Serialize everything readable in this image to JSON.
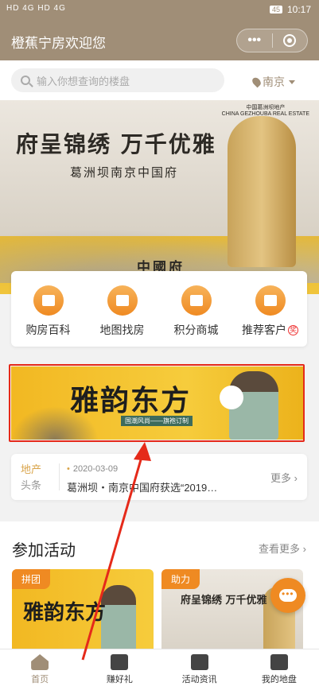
{
  "statusbar": {
    "left": "HD 4G HD 4G",
    "battery": "45",
    "time": "10:17"
  },
  "header": {
    "title": "橙蕉宁房欢迎您",
    "more": "•••"
  },
  "search": {
    "placeholder": "输入你想查询的楼盘",
    "city": "南京"
  },
  "hero": {
    "title": "府呈锦绣 万千优雅",
    "subtitle": "葛洲坝南京中国府",
    "logo_cn": "中国葛洲坝地产",
    "logo_en": "CHINA GEZHOUBA REAL ESTATE",
    "brand": "中國府"
  },
  "quick": [
    {
      "label": "购房百科"
    },
    {
      "label": "地图找房"
    },
    {
      "label": "积分商城"
    },
    {
      "label": "推荐客户",
      "badge": "奖"
    }
  ],
  "promo": {
    "title": "雅韵东方",
    "tag": "国潮风尚——旗袍订制"
  },
  "news": {
    "label_a": "地产",
    "label_b": "头条",
    "date": "2020-03-09",
    "text": "葛洲坝・南京中国府获选“2019…",
    "more": "更多 ›"
  },
  "activities": {
    "title": "参加活动",
    "more": "查看更多 ›",
    "cards": [
      {
        "tag": "拼团",
        "text": "雅韵东方"
      },
      {
        "tag": "助力",
        "text": "府呈锦绣 万千优雅"
      }
    ]
  },
  "tabs": [
    {
      "label": "首页",
      "active": true
    },
    {
      "label": "赚好礼"
    },
    {
      "label": "活动资讯"
    },
    {
      "label": "我的地盘"
    }
  ],
  "colors": {
    "brand": "#a08e77",
    "accent": "#ef8a22",
    "highlight": "#e52a1a"
  }
}
